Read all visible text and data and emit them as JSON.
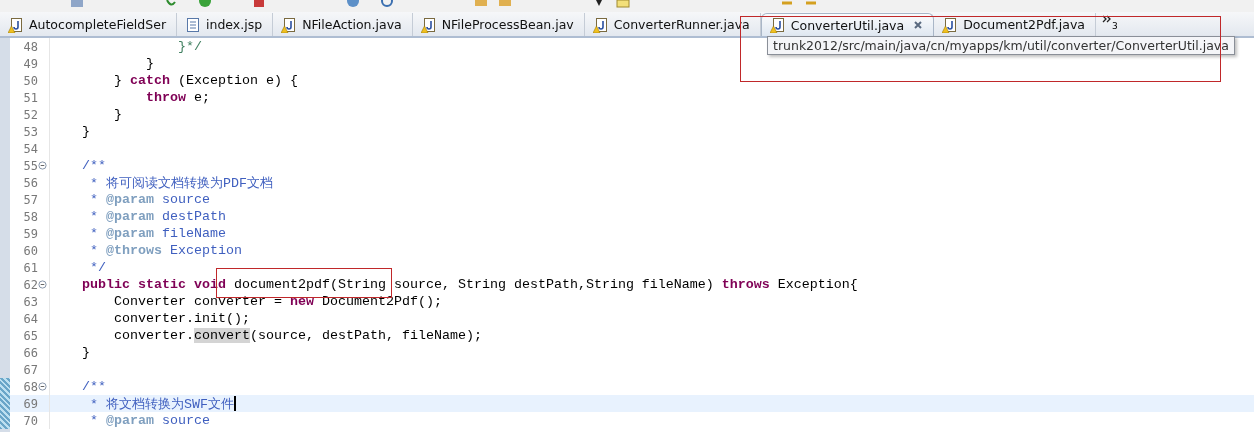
{
  "tabs": [
    {
      "label": "AutocompleteFieldSer",
      "kind": "java",
      "warning": true,
      "selected": false
    },
    {
      "label": "index.jsp",
      "kind": "jsp",
      "warning": false,
      "selected": false
    },
    {
      "label": "NFileAction.java",
      "kind": "java",
      "warning": true,
      "selected": false
    },
    {
      "label": "NFileProcessBean.jav",
      "kind": "java",
      "warning": true,
      "selected": false
    },
    {
      "label": "ConverterRunner.java",
      "kind": "java",
      "warning": true,
      "selected": false
    },
    {
      "label": "ConverterUtil.java",
      "kind": "java",
      "warning": true,
      "selected": true
    },
    {
      "label": "Document2Pdf.java",
      "kind": "java",
      "warning": true,
      "selected": false
    }
  ],
  "overflow": {
    "count": "3"
  },
  "tooltip": {
    "text": "trunk2012/src/main/java/cn/myapps/km/util/converter/ConverterUtil.java"
  },
  "editor": {
    "lines": [
      {
        "number": "48",
        "fold": false,
        "changed": false,
        "current": false,
        "tokens": [
          {
            "kind": "comment",
            "text": "                }*/"
          }
        ]
      },
      {
        "number": "49",
        "fold": false,
        "changed": false,
        "current": false,
        "tokens": [
          {
            "kind": "plain",
            "text": "            }"
          }
        ]
      },
      {
        "number": "50",
        "fold": false,
        "changed": false,
        "current": false,
        "tokens": [
          {
            "kind": "plain",
            "text": "        } "
          },
          {
            "kind": "keyword",
            "text": "catch"
          },
          {
            "kind": "plain",
            "text": " (Exception e) {"
          }
        ]
      },
      {
        "number": "51",
        "fold": false,
        "changed": false,
        "current": false,
        "tokens": [
          {
            "kind": "keyword",
            "text": "            throw"
          },
          {
            "kind": "plain",
            "text": " e;"
          }
        ]
      },
      {
        "number": "52",
        "fold": false,
        "changed": false,
        "current": false,
        "tokens": [
          {
            "kind": "plain",
            "text": "        }"
          }
        ]
      },
      {
        "number": "53",
        "fold": false,
        "changed": false,
        "current": false,
        "tokens": [
          {
            "kind": "plain",
            "text": "    }"
          }
        ]
      },
      {
        "number": "54",
        "fold": false,
        "changed": false,
        "current": false
      },
      {
        "number": "55",
        "fold": true,
        "changed": false,
        "current": false,
        "tokens": [
          {
            "kind": "doc",
            "text": "    /**"
          }
        ]
      },
      {
        "number": "56",
        "fold": false,
        "changed": false,
        "current": false,
        "tokens": [
          {
            "kind": "doc",
            "text": "     * 将可阅读文档转换为PDF文档"
          }
        ]
      },
      {
        "number": "57",
        "fold": false,
        "changed": false,
        "current": false,
        "tokens": [
          {
            "kind": "doc",
            "text": "     * "
          },
          {
            "kind": "doctag",
            "text": "@param"
          },
          {
            "kind": "doc",
            "text": " source"
          }
        ]
      },
      {
        "number": "58",
        "fold": false,
        "changed": false,
        "current": false,
        "tokens": [
          {
            "kind": "doc",
            "text": "     * "
          },
          {
            "kind": "doctag",
            "text": "@param"
          },
          {
            "kind": "doc",
            "text": " destPath"
          }
        ]
      },
      {
        "number": "59",
        "fold": false,
        "changed": false,
        "current": false,
        "tokens": [
          {
            "kind": "doc",
            "text": "     * "
          },
          {
            "kind": "doctag",
            "text": "@param"
          },
          {
            "kind": "doc",
            "text": " fileName"
          }
        ]
      },
      {
        "number": "60",
        "fold": false,
        "changed": false,
        "current": false,
        "tokens": [
          {
            "kind": "doc",
            "text": "     * "
          },
          {
            "kind": "doctag",
            "text": "@throws"
          },
          {
            "kind": "doc",
            "text": " Exception"
          }
        ]
      },
      {
        "number": "61",
        "fold": false,
        "changed": false,
        "current": false,
        "tokens": [
          {
            "kind": "doc",
            "text": "     */"
          }
        ]
      },
      {
        "number": "62",
        "fold": true,
        "changed": false,
        "current": false,
        "tokens": [
          {
            "kind": "keyword",
            "text": "    public static void"
          },
          {
            "kind": "plain",
            "text": " document2pdf(String source, String destPath,String fileName) "
          },
          {
            "kind": "keyword",
            "text": "throws"
          },
          {
            "kind": "plain",
            "text": " Exception{"
          }
        ]
      },
      {
        "number": "63",
        "fold": false,
        "changed": false,
        "current": false,
        "tokens": [
          {
            "kind": "plain",
            "text": "        Converter converter = "
          },
          {
            "kind": "keyword",
            "text": "new"
          },
          {
            "kind": "plain",
            "text": " Document2Pdf();"
          }
        ]
      },
      {
        "number": "64",
        "fold": false,
        "changed": false,
        "current": false,
        "tokens": [
          {
            "kind": "plain",
            "text": "        converter.init();"
          }
        ]
      },
      {
        "number": "65",
        "fold": false,
        "changed": false,
        "current": false,
        "tokens": [
          {
            "kind": "plain",
            "text": "        converter."
          },
          {
            "kind": "occurrence",
            "text": "convert"
          },
          {
            "kind": "plain",
            "text": "(source, destPath, fileName);"
          }
        ]
      },
      {
        "number": "66",
        "fold": false,
        "changed": false,
        "current": false,
        "tokens": [
          {
            "kind": "plain",
            "text": "    }"
          }
        ]
      },
      {
        "number": "67",
        "fold": false,
        "changed": false,
        "current": false
      },
      {
        "number": "68",
        "fold": true,
        "changed": true,
        "current": false,
        "tokens": [
          {
            "kind": "doc",
            "text": "    /**"
          }
        ]
      },
      {
        "number": "69",
        "fold": false,
        "changed": true,
        "current": true,
        "tokens": [
          {
            "kind": "doc",
            "text": "     * 将文档转换为SWF文件"
          }
        ]
      },
      {
        "number": "70",
        "fold": false,
        "changed": true,
        "current": false,
        "tokens": [
          {
            "kind": "doc",
            "text": "     * "
          },
          {
            "kind": "doctag",
            "text": "@param"
          },
          {
            "kind": "doc",
            "text": " source"
          }
        ]
      }
    ]
  }
}
